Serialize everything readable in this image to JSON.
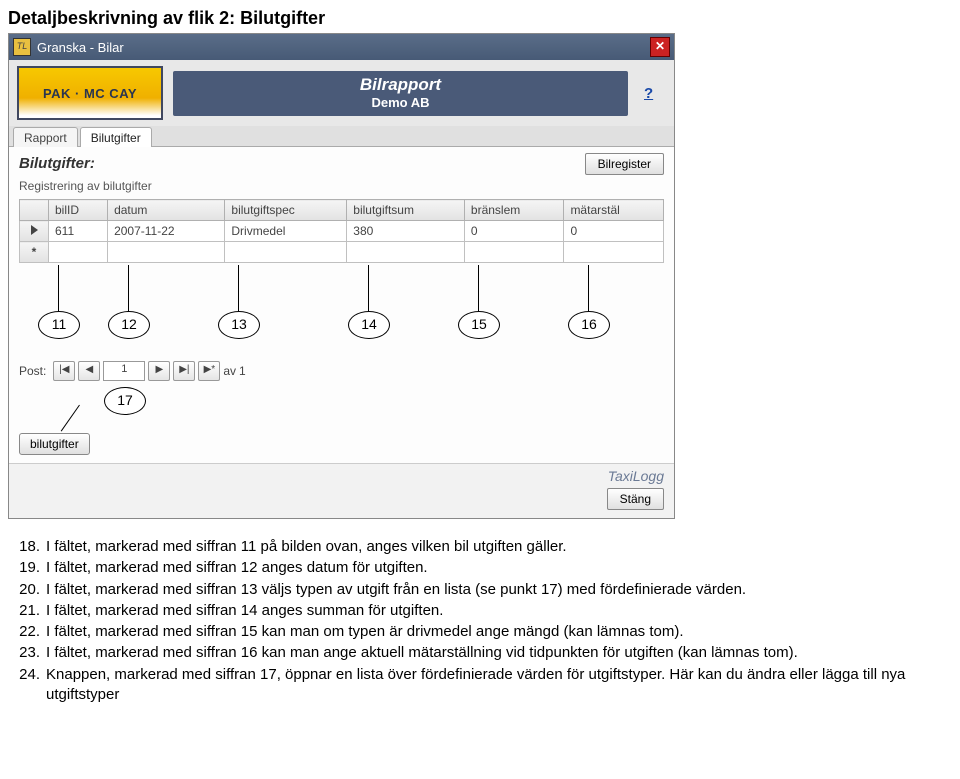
{
  "page_title": "Detaljbeskrivning av flik 2: Bilutgifter",
  "window": {
    "title": "Granska - Bilar",
    "app_icon_label": "TL",
    "close_label": "✕",
    "help_label": "?"
  },
  "logo_text": "PAK · MC CAY",
  "header": {
    "title": "Bilrapport",
    "subtitle": "Demo AB"
  },
  "tabs": [
    "Rapport",
    "Bilutgifter"
  ],
  "section": {
    "title": "Bilutgifter:",
    "button": "Bilregister",
    "subtext": "Registrering av bilutgifter"
  },
  "grid": {
    "headers": [
      "bilID",
      "datum",
      "bilutgiftspec",
      "bilutgiftsum",
      "bränslem",
      "mätarstäl"
    ],
    "row": {
      "bilID": "611",
      "datum": "2007-11-22",
      "spec": "Drivmedel",
      "sum": "380",
      "branslem": "0",
      "matar": "0"
    }
  },
  "callouts": [
    "11",
    "12",
    "13",
    "14",
    "15",
    "16"
  ],
  "nav": {
    "label": "Post:",
    "first": "|◀",
    "prev": "◀",
    "value": "1",
    "next": "▶",
    "last": "▶|",
    "new": "▶*",
    "of_label": "av",
    "total": "1"
  },
  "callout_17": "17",
  "bottom_tab": "bilutgifter",
  "footer": {
    "brand": "TaxiLogg",
    "close_btn": "Stäng"
  },
  "explanations": [
    {
      "n": "18.",
      "t": "I fältet, markerad med siffran 11 på bilden ovan, anges vilken bil utgiften gäller."
    },
    {
      "n": "19.",
      "t": "I fältet, markerad med siffran 12 anges datum för utgiften."
    },
    {
      "n": "20.",
      "t": "I fältet, markerad med siffran  13 väljs typen av utgift från en lista (se punkt 17) med fördefinierade värden."
    },
    {
      "n": "21.",
      "t": "I fältet, markerad med siffran 14 anges summan för utgiften."
    },
    {
      "n": "22.",
      "t": "I fältet, markerad med siffran 15 kan man om typen är drivmedel ange mängd (kan lämnas tom)."
    },
    {
      "n": "23.",
      "t": "I fältet, markerad med siffran 16 kan man ange aktuell mätarställning vid tidpunkten för utgiften (kan lämnas tom)."
    },
    {
      "n": "24.",
      "t": "Knappen, markerad med siffran 17, öppnar en lista över fördefinierade värden för utgiftstyper. Här kan du ändra eller lägga till nya utgiftstyper"
    }
  ]
}
